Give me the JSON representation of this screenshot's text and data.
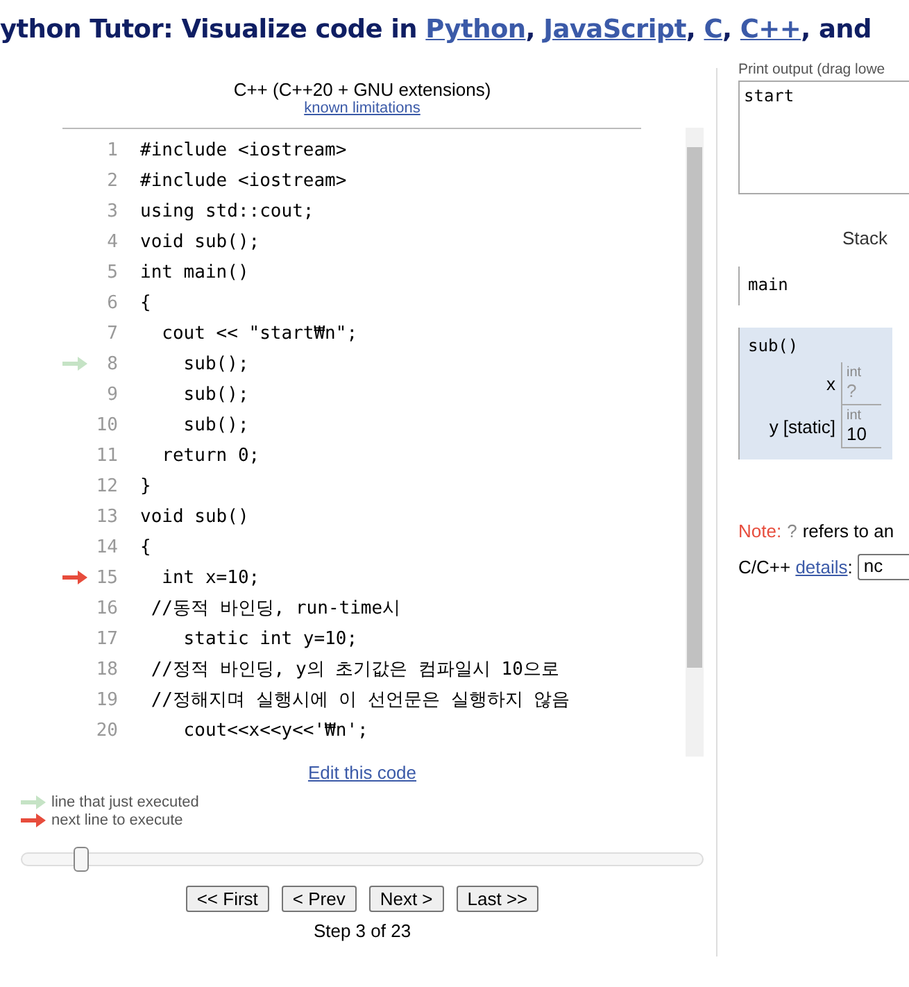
{
  "header": {
    "segments": [
      {
        "kind": "text",
        "text": "ython Tutor: Visualize code in "
      },
      {
        "kind": "link",
        "text": "Python"
      },
      {
        "kind": "text",
        "text": ", "
      },
      {
        "kind": "link",
        "text": "JavaScript"
      },
      {
        "kind": "text",
        "text": ", "
      },
      {
        "kind": "link",
        "text": "C"
      },
      {
        "kind": "text",
        "text": ", "
      },
      {
        "kind": "link",
        "text": "C++"
      },
      {
        "kind": "text",
        "text": ", and"
      }
    ]
  },
  "editor": {
    "language": "C++ (C++20 + GNU extensions)",
    "limitations_link": "known limitations",
    "lines": [
      {
        "number": "1",
        "code": "#include <iostream>",
        "just_executed": false,
        "next": false
      },
      {
        "number": "2",
        "code": "#include <iostream>",
        "just_executed": false,
        "next": false
      },
      {
        "number": "3",
        "code": "using std::cout;",
        "just_executed": false,
        "next": false
      },
      {
        "number": "4",
        "code": "void sub();",
        "just_executed": false,
        "next": false
      },
      {
        "number": "5",
        "code": "int main()",
        "just_executed": false,
        "next": false
      },
      {
        "number": "6",
        "code": "{",
        "just_executed": false,
        "next": false
      },
      {
        "number": "7",
        "code": "  cout << \"start₩n\";",
        "just_executed": false,
        "next": false
      },
      {
        "number": "8",
        "code": "    sub();",
        "just_executed": true,
        "next": false
      },
      {
        "number": "9",
        "code": "    sub();",
        "just_executed": false,
        "next": false
      },
      {
        "number": "10",
        "code": "    sub();",
        "just_executed": false,
        "next": false
      },
      {
        "number": "11",
        "code": "  return 0;",
        "just_executed": false,
        "next": false
      },
      {
        "number": "12",
        "code": "}",
        "just_executed": false,
        "next": false
      },
      {
        "number": "13",
        "code": "void sub()",
        "just_executed": false,
        "next": false
      },
      {
        "number": "14",
        "code": "{",
        "just_executed": false,
        "next": false
      },
      {
        "number": "15",
        "code": "  int x=10;",
        "just_executed": false,
        "next": true
      },
      {
        "number": "16",
        "code": " //동적 바인딩, run-time시",
        "just_executed": false,
        "next": false
      },
      {
        "number": "17",
        "code": "    static int y=10;",
        "just_executed": false,
        "next": false
      },
      {
        "number": "18",
        "code": " //정적 바인딩, y의 초기값은 컴파일시 10으로",
        "just_executed": false,
        "next": false
      },
      {
        "number": "19",
        "code": " //정해지며 실행시에 이 선언문은 실행하지 않음",
        "just_executed": false,
        "next": false
      },
      {
        "number": "20",
        "code": "    cout<<x<<y<<'₩n';",
        "just_executed": false,
        "next": false
      }
    ],
    "edit_link": "Edit this code"
  },
  "legend": [
    {
      "kind": "prev",
      "label": "line that just executed"
    },
    {
      "kind": "next",
      "label": "next line to execute"
    }
  ],
  "slider": {
    "level": 0.09
  },
  "buttons": [
    "<< First",
    "< Prev",
    "Next >",
    "Last >>"
  ],
  "step_text": "Step 3 of 23",
  "output": {
    "label": "Print output (drag lowe",
    "text": "start"
  },
  "stack": {
    "title": "Stack",
    "frames": [
      {
        "name": "main",
        "highlighted": false
      },
      {
        "name": "sub()",
        "highlighted": true,
        "variables": [
          {
            "name": "x",
            "type": "int",
            "value": "?",
            "initialized": false
          },
          {
            "name": "y [static]",
            "type": "int",
            "value": "10",
            "initialized": true
          }
        ]
      }
    ]
  },
  "note": {
    "label": "Note:",
    "mark": "?",
    "text": "refers to an"
  },
  "details": {
    "prefix": "C/C++ ",
    "link": "details",
    "suffix": ":",
    "select_value": "nc"
  }
}
